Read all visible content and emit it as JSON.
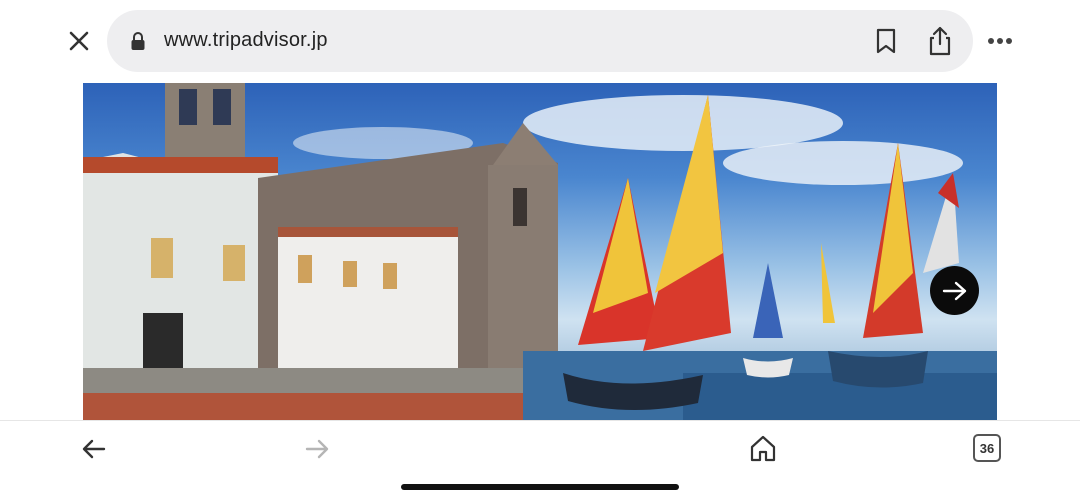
{
  "browser": {
    "url": "www.tripadvisor.jp",
    "tab_count": "36"
  },
  "icons": {
    "close": "close-icon",
    "lock": "lock-icon",
    "bookmark": "bookmark-icon",
    "share": "share-icon",
    "more": "more-icon",
    "next": "arrow-right-icon",
    "back": "back-arrow-icon",
    "forward": "forward-arrow-icon",
    "home": "home-icon"
  }
}
